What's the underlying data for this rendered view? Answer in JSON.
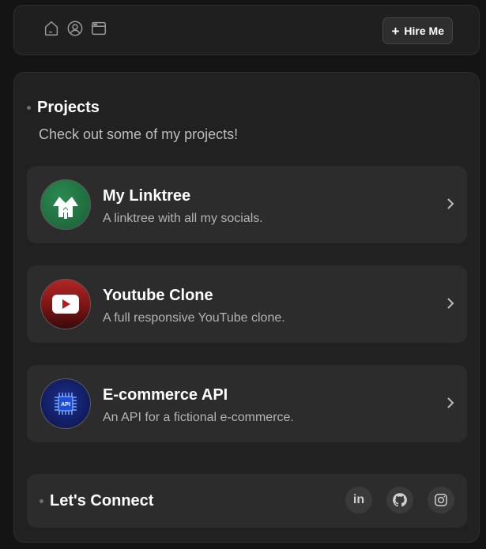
{
  "navbar": {
    "icons": [
      "home-icon",
      "user-icon",
      "browser-icon"
    ],
    "hire_label": "Hire Me",
    "hire_icon": "plus-icon"
  },
  "projects_section": {
    "title": "Projects",
    "subtitle": "Check out some of my projects!",
    "items": [
      {
        "title": "My Linktree",
        "description": "A linktree with all my socials.",
        "icon": "linktree-logo",
        "accent": "#1f7a45"
      },
      {
        "title": "Youtube Clone",
        "description": "A full responsive YouTube clone.",
        "icon": "youtube-logo",
        "accent": "#a51e1e"
      },
      {
        "title": "E-commerce API",
        "description": "An API for a fictional e-commerce.",
        "icon": "api-chip-logo",
        "accent": "#1a2a8a"
      }
    ]
  },
  "connect": {
    "title": "Let's Connect",
    "socials": [
      {
        "name": "linkedin",
        "icon": "linkedin-icon",
        "text": "in"
      },
      {
        "name": "github",
        "icon": "github-icon"
      },
      {
        "name": "instagram",
        "icon": "instagram-icon"
      }
    ]
  },
  "logo_text": {
    "api": "API"
  },
  "colors": {
    "background": "#141414",
    "card": "#212121",
    "item": "#2c2c2c",
    "muted_text": "#b3b3b3"
  }
}
